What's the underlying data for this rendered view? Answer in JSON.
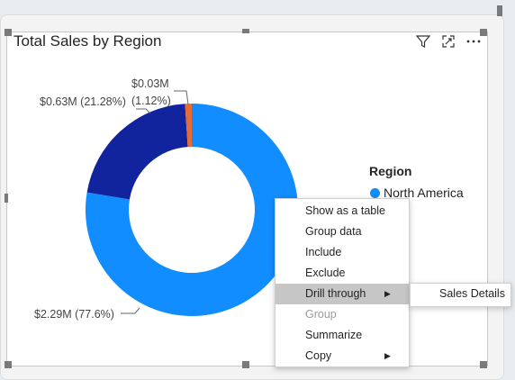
{
  "visual": {
    "title": "Total Sales by Region",
    "header_icons": [
      "filter-icon",
      "focus-mode-icon",
      "more-options-icon"
    ]
  },
  "chart_data": {
    "type": "donut",
    "slices": [
      {
        "value": 2.29,
        "label": "$2.29M (77.6%)",
        "percent": 77.6,
        "color": "#118DFF",
        "legend": "North America"
      },
      {
        "value": 0.63,
        "label": "$0.63M (21.28%)",
        "percent": 21.28,
        "color": "#12239E"
      },
      {
        "value": 0.03,
        "label_top": "$0.03M",
        "label_bottom": "(1.12%)",
        "percent": 1.12,
        "color": "#E66C37"
      }
    ],
    "legend": {
      "title": "Region",
      "items": [
        {
          "name": "North America",
          "color": "#118DFF"
        },
        {
          "name": "pe",
          "color": "#12239E"
        },
        {
          "name": "fic",
          "color": "#E66C37"
        }
      ]
    }
  },
  "context_menu": {
    "items": [
      {
        "label": "Show as a table",
        "submenu": false,
        "disabled": false,
        "highlighted": false
      },
      {
        "label": "Group data",
        "submenu": false,
        "disabled": false,
        "highlighted": false
      },
      {
        "label": "Include",
        "submenu": false,
        "disabled": false,
        "highlighted": false
      },
      {
        "label": "Exclude",
        "submenu": false,
        "disabled": false,
        "highlighted": false
      },
      {
        "label": "Drill through",
        "submenu": true,
        "disabled": false,
        "highlighted": true
      },
      {
        "label": "Group",
        "submenu": false,
        "disabled": true,
        "highlighted": false
      },
      {
        "label": "Summarize",
        "submenu": false,
        "disabled": false,
        "highlighted": false
      },
      {
        "label": "Copy",
        "submenu": true,
        "disabled": false,
        "highlighted": false
      }
    ],
    "submenu": {
      "items": [
        {
          "label": "Sales Details"
        }
      ]
    }
  }
}
